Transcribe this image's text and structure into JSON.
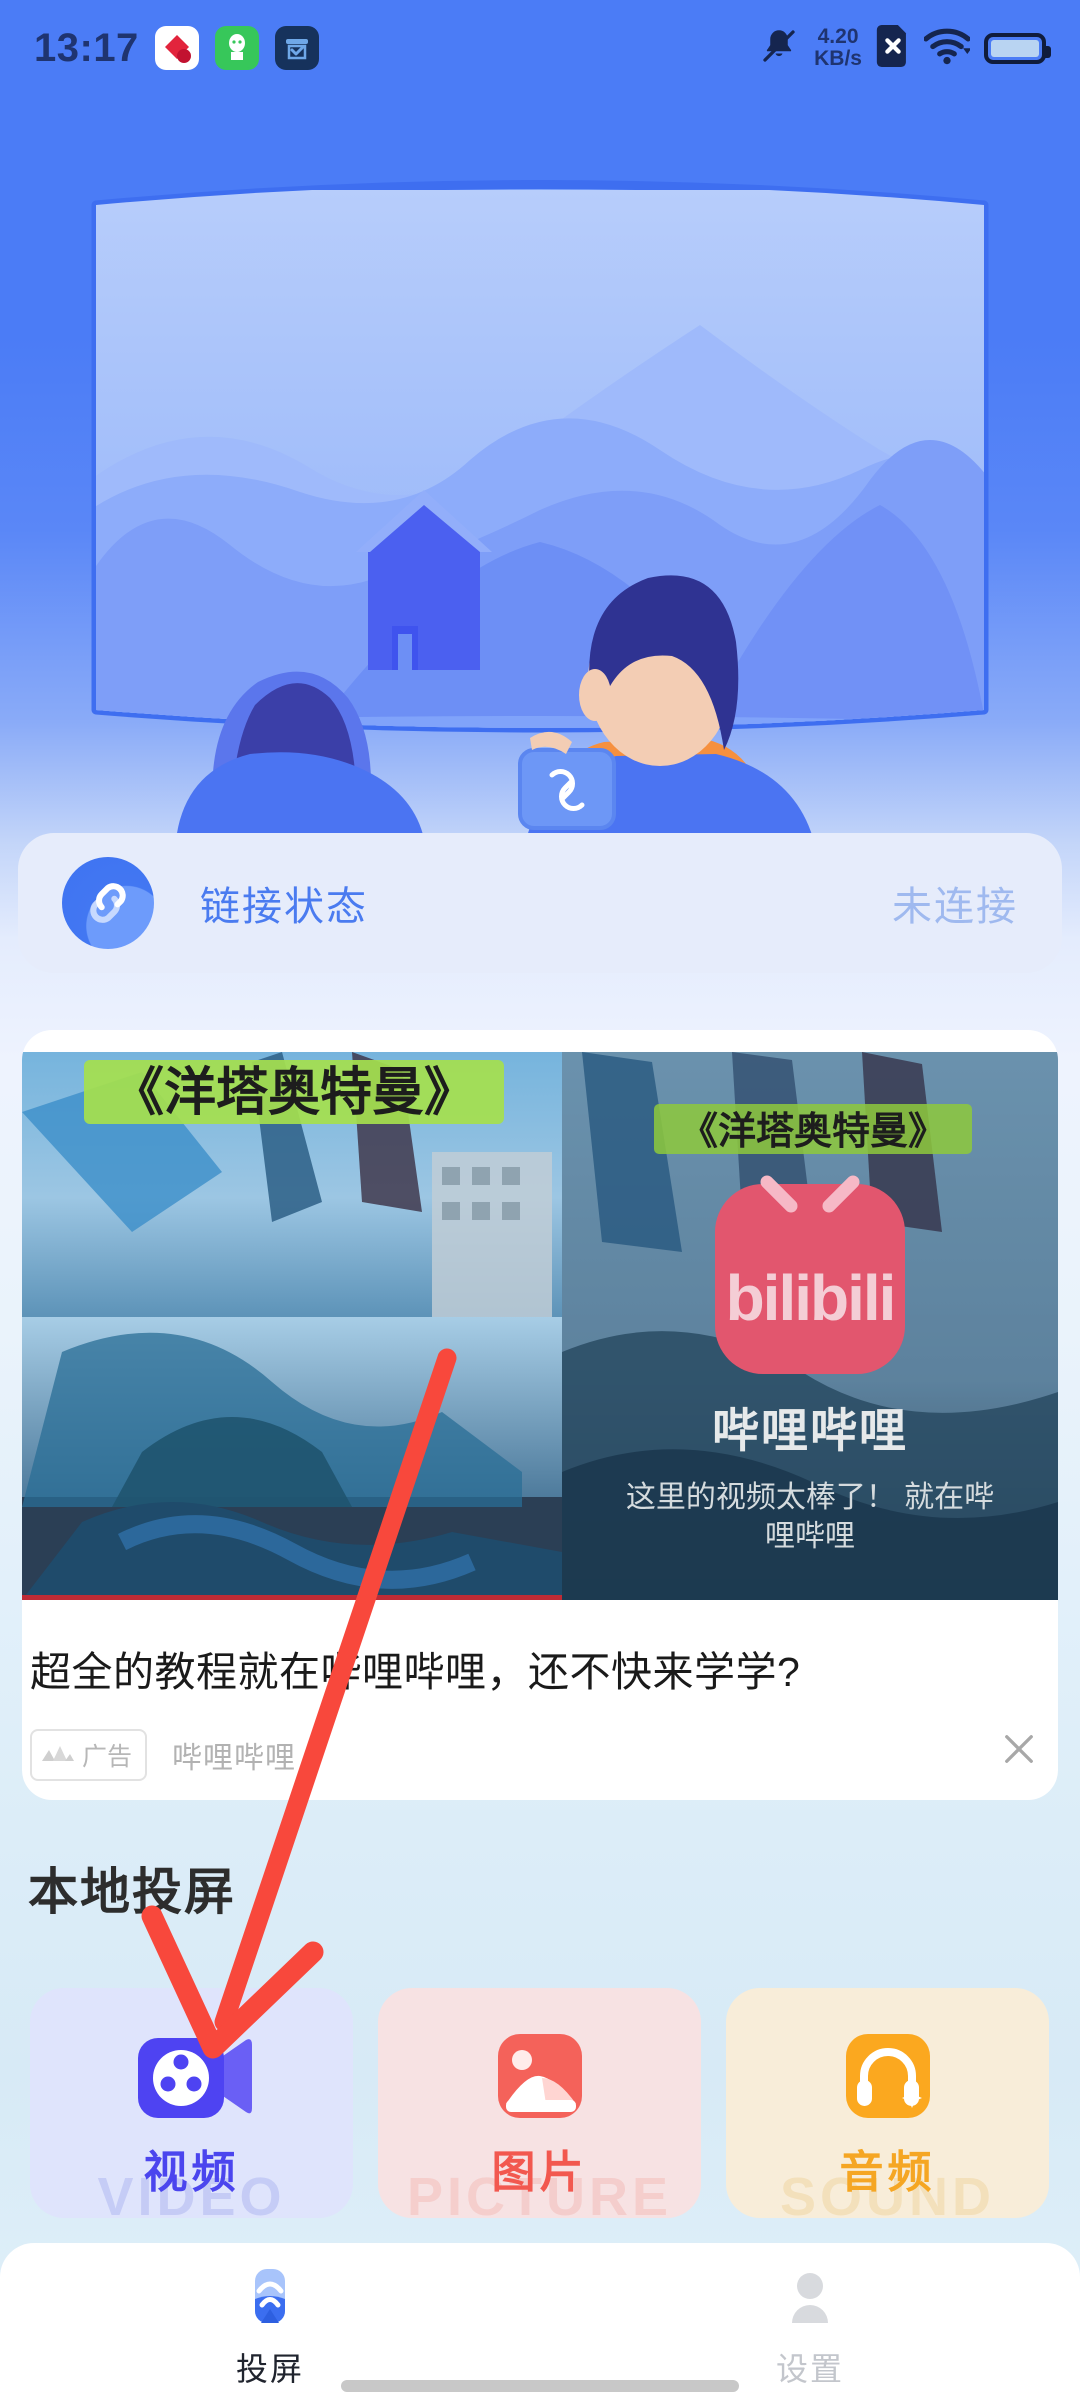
{
  "status_bar": {
    "time": "13:17",
    "network_speed": "4.20",
    "network_speed_unit": "KB/s",
    "notification_icons": [
      "kuaishou-icon",
      "alipay-icon",
      "notes-icon"
    ],
    "icons": [
      "bell-muted-icon",
      "sim-card-disabled-icon",
      "wifi-icon",
      "battery-icon"
    ]
  },
  "hero": {
    "alt": "two-people-watching-tv-illustration"
  },
  "link_status": {
    "icon": "chain-link-icon",
    "label": "链接状态",
    "value": "未连接"
  },
  "ad": {
    "overlay_title": "《洋塔奥特曼》",
    "brand_name": "哔哩哔哩",
    "brand_tagline": "这里的视频太棒了！就在哔哩哔哩",
    "logo_text": "bilibili",
    "title": "超全的教程就在哔哩哔哩，还不快来学学?",
    "badge_label": "广告",
    "badge_icon": "ad-mountain-icon",
    "source": "哔哩哔哩",
    "close_icon": "close-icon"
  },
  "local_cast": {
    "section_title": "本地投屏",
    "cards": [
      {
        "cn": "视频",
        "en": "VIDEO",
        "icon": "video-camera-icon",
        "bg": "#dfe4fc",
        "text_color": "#4b45ee",
        "icon_bg": "#4e43f2"
      },
      {
        "cn": "图片",
        "en": "PICTURE",
        "icon": "picture-image-icon",
        "bg": "#f7e2e3",
        "text_color": "#f2584f",
        "icon_bg": "#f4625a"
      },
      {
        "cn": "音频",
        "en": "SOUND",
        "icon": "headphones-icon",
        "bg": "#f8edd9",
        "text_color": "#f5a623",
        "icon_bg": "#fba81f"
      }
    ]
  },
  "bottom_nav": {
    "items": [
      {
        "label": "投屏",
        "icon": "cast-icon",
        "active": true
      },
      {
        "label": "设置",
        "icon": "person-icon",
        "active": false
      }
    ]
  },
  "annotation": {
    "arrow_color": "#f8483c",
    "points_to": "视频"
  },
  "colors": {
    "primary_blue": "#4b7cf6",
    "accent_blue": "#4a7bf0",
    "card_bg": "#e6ecfb",
    "white": "#ffffff"
  }
}
